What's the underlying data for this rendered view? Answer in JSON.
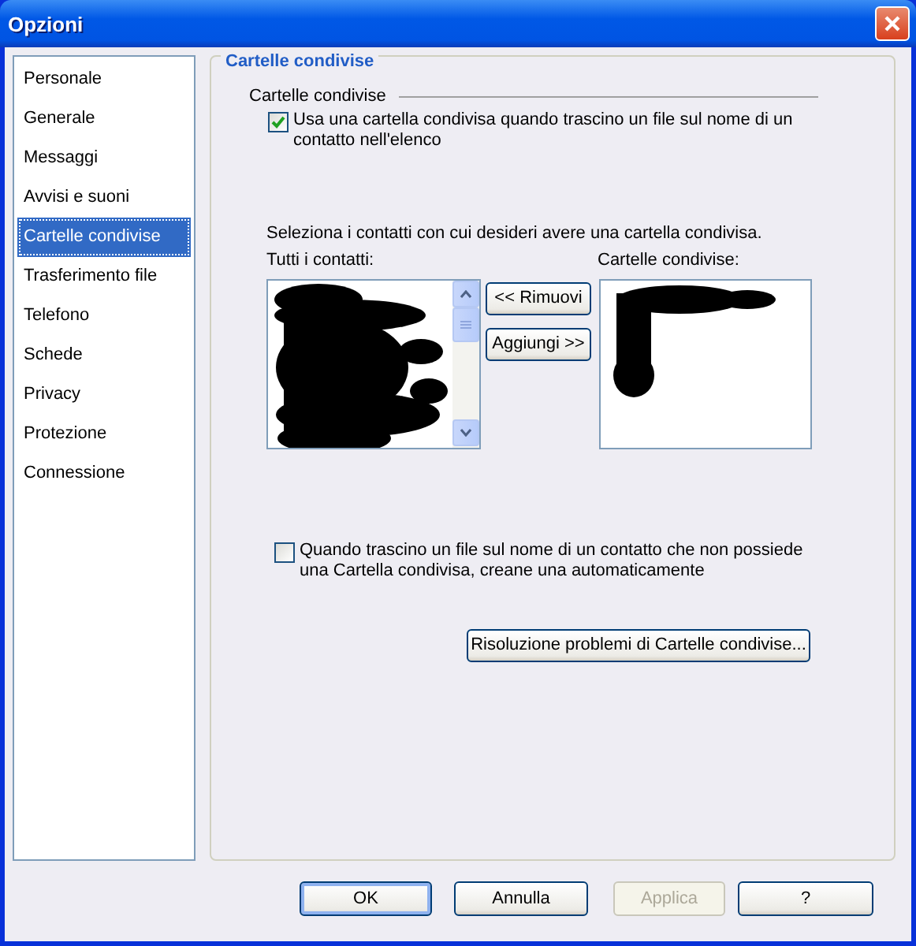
{
  "window": {
    "title": "Opzioni"
  },
  "sidebar": {
    "items": [
      {
        "label": "Personale",
        "selected": false
      },
      {
        "label": "Generale",
        "selected": false
      },
      {
        "label": "Messaggi",
        "selected": false
      },
      {
        "label": "Avvisi e suoni",
        "selected": false
      },
      {
        "label": "Cartelle condivise",
        "selected": true
      },
      {
        "label": "Trasferimento file",
        "selected": false
      },
      {
        "label": "Telefono",
        "selected": false
      },
      {
        "label": "Schede",
        "selected": false
      },
      {
        "label": "Privacy",
        "selected": false
      },
      {
        "label": "Protezione",
        "selected": false
      },
      {
        "label": "Connessione",
        "selected": false
      }
    ]
  },
  "panel": {
    "title": "Cartelle condivise",
    "section_label": "Cartelle condivise",
    "drag_option": {
      "label": "Usa una cartella condivisa quando trascino un file sul nome di un contatto nell'elenco",
      "checked": true
    },
    "instruction": "Seleziona i contatti con cui desideri avere una cartella condivisa.",
    "all_contacts_label": "Tutti i contatti:",
    "shared_label": "Cartelle condivise:",
    "remove_button": "<< Rimuovi",
    "add_button": "Aggiungi >>",
    "auto_create_option": {
      "label": "Quando trascino un file sul nome di un contatto che non possiede una Cartella condivisa, creane una automaticamente",
      "checked": false
    },
    "troubleshoot_button": "Risoluzione problemi di Cartelle condivise..."
  },
  "buttons": [
    {
      "label": "OK",
      "disabled": false,
      "default": true
    },
    {
      "label": "Annulla",
      "disabled": false,
      "default": false
    },
    {
      "label": "Applica",
      "disabled": true,
      "default": false
    },
    {
      "label": "?",
      "disabled": false,
      "default": false
    }
  ]
}
